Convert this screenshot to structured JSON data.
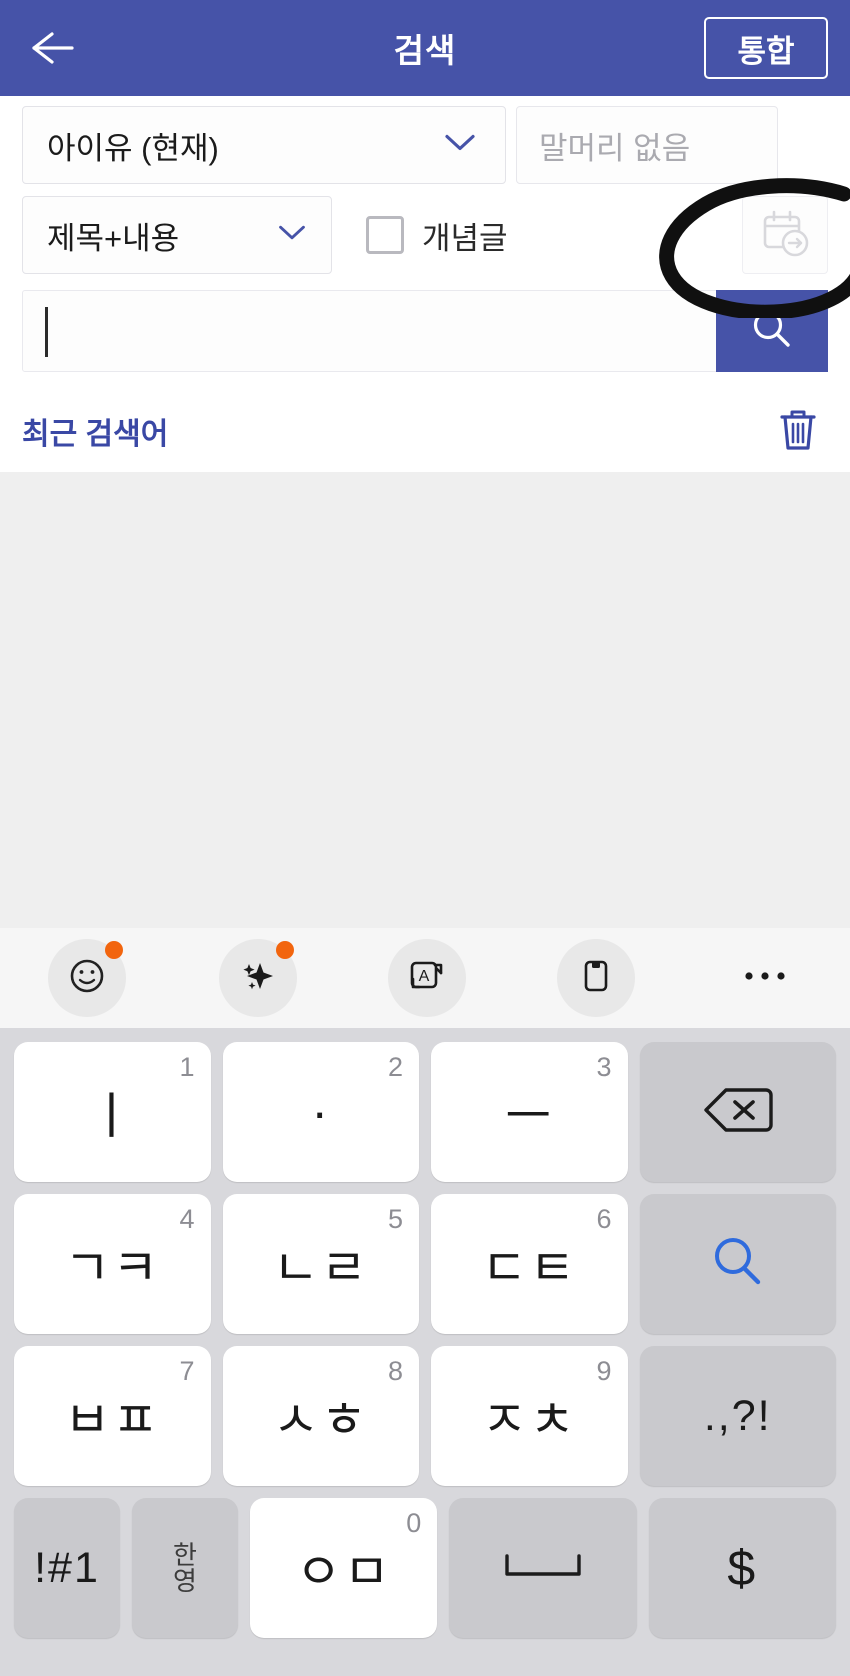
{
  "header": {
    "back_icon": "arrow-left-icon",
    "title": "검색",
    "action_label": "통합",
    "bg_color": "#4653a8"
  },
  "filters": {
    "board_select": {
      "value": "아이유 (현재)",
      "chevron_icon": "chevron-down-icon"
    },
    "prefix_field": {
      "placeholder": "말머리 없음",
      "value": ""
    },
    "scope_select": {
      "value": "제목+내용",
      "chevron_icon": "chevron-down-icon"
    },
    "concept_checkbox": {
      "label": "개념글",
      "checked": false
    },
    "date_button": {
      "icon": "calendar-arrow-icon"
    }
  },
  "annotation": {
    "type": "hand-drawn-circle",
    "color": "#111111",
    "target": "date-range-button"
  },
  "search": {
    "input_value": "",
    "placeholder": "",
    "go_icon": "search-icon",
    "go_bg": "#4653a8"
  },
  "recent": {
    "label": "최근 검색어",
    "label_color": "#3a48a5",
    "clear_icon": "trash-icon",
    "items": []
  },
  "keyboard_toolbar": {
    "items": [
      {
        "name": "emoji-icon",
        "badge": true
      },
      {
        "name": "sparkle-ai-icon",
        "badge": true
      },
      {
        "name": "translate-icon",
        "badge": false
      },
      {
        "name": "clipboard-icon",
        "badge": false
      },
      {
        "name": "more-options-icon",
        "badge": false
      }
    ],
    "badge_color": "#f2650e"
  },
  "keyboard": {
    "layout_name": "chonjiin",
    "rows": [
      [
        {
          "label": "ㅣ",
          "num": "1",
          "style": "white",
          "icon": ""
        },
        {
          "label": "·",
          "num": "2",
          "style": "white",
          "icon": ""
        },
        {
          "label": "ㅡ",
          "num": "3",
          "style": "white",
          "icon": ""
        },
        {
          "label": "",
          "num": "",
          "style": "gray",
          "icon": "backspace-icon"
        }
      ],
      [
        {
          "label": "ㄱㅋ",
          "num": "4",
          "style": "white",
          "icon": ""
        },
        {
          "label": "ㄴㄹ",
          "num": "5",
          "style": "white",
          "icon": ""
        },
        {
          "label": "ㄷㅌ",
          "num": "6",
          "style": "white",
          "icon": ""
        },
        {
          "label": "",
          "num": "",
          "style": "gray",
          "icon": "search-key-icon"
        }
      ],
      [
        {
          "label": "ㅂㅍ",
          "num": "7",
          "style": "white",
          "icon": ""
        },
        {
          "label": "ㅅㅎ",
          "num": "8",
          "style": "white",
          "icon": ""
        },
        {
          "label": "ㅈㅊ",
          "num": "9",
          "style": "white",
          "icon": ""
        },
        {
          "label": ".,?!",
          "num": "",
          "style": "gray",
          "icon": ""
        }
      ],
      [
        {
          "label": "!#1",
          "num": "",
          "style": "gray",
          "icon": ""
        },
        {
          "label": "한/영",
          "num": "",
          "style": "gray",
          "icon": "lang-toggle-icon"
        },
        {
          "label": "ㅇㅁ",
          "num": "0",
          "style": "white",
          "icon": ""
        },
        {
          "label": "",
          "num": "",
          "style": "gray",
          "icon": "space-icon"
        },
        {
          "label": "$",
          "num": "",
          "style": "gray",
          "icon": ""
        }
      ]
    ]
  }
}
